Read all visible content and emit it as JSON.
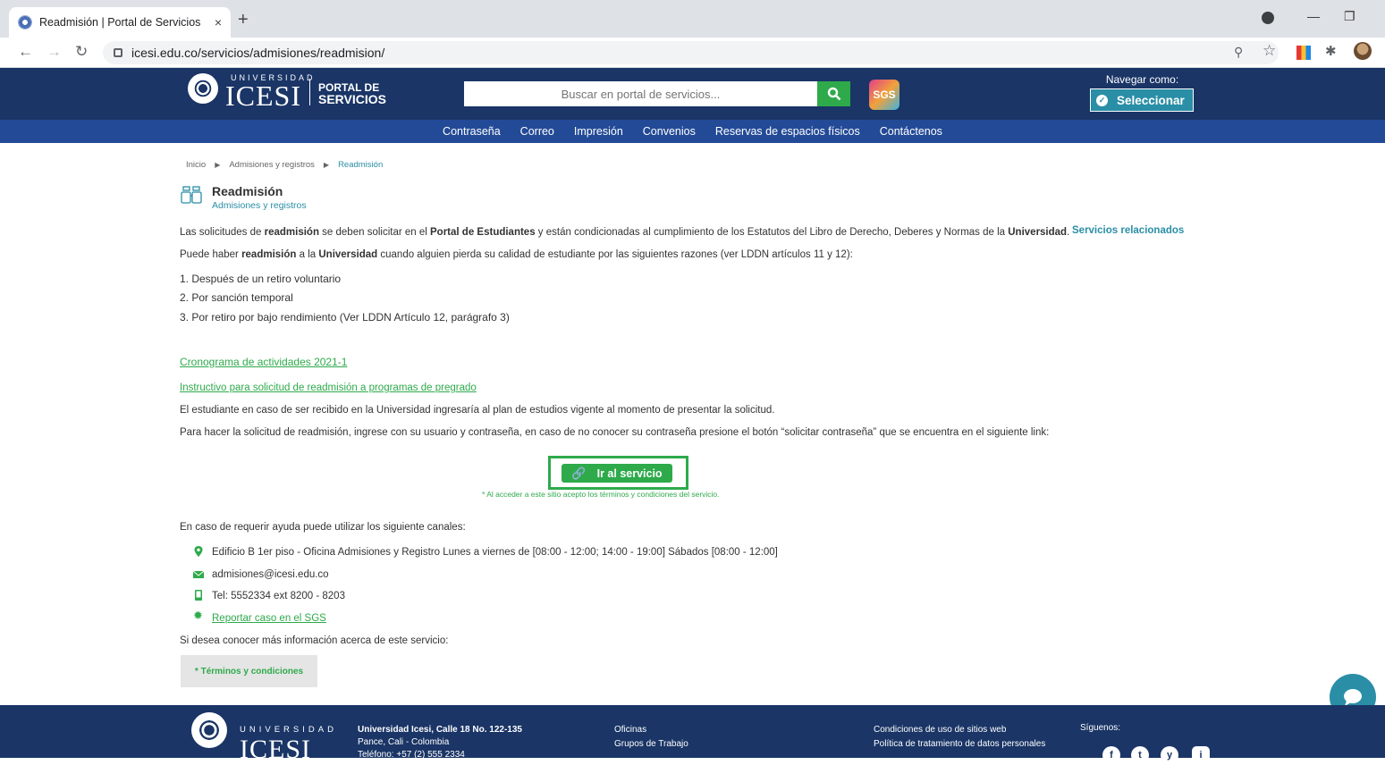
{
  "browser": {
    "tab_title": "Readmisión | Portal de Servicios",
    "tab_close": "×",
    "new_tab": "+",
    "url": "icesi.edu.co/servicios/admisiones/readmision/"
  },
  "header": {
    "logo_universidad": "UNIVERSIDAD",
    "logo_icesi": "ICESI",
    "logo_portal_1": "PORTAL DE",
    "logo_portal_2": "SERVICIOS",
    "search_placeholder": "Buscar en portal de servicios...",
    "sgs": "SGS",
    "navegar_label": "Navegar como:",
    "select_label": "Seleccionar"
  },
  "nav": [
    "Contraseña",
    "Correo",
    "Impresión",
    "Convenios",
    "Reservas de espacios físicos",
    "Contáctenos"
  ],
  "breadcrumb": {
    "home": "Inicio",
    "section": "Admisiones y registros",
    "current": "Readmisión"
  },
  "page": {
    "title": "Readmisión",
    "subtitle": "Admisiones y registros",
    "intro_a": "Las solicitudes de ",
    "intro_b": "readmisión",
    "intro_c": " se deben solicitar en el ",
    "intro_d": "Portal de Estudiantes",
    "intro_e": " y están condicionadas al cumplimiento de los Estatutos del Libro de Derecho, Deberes y Normas de la ",
    "intro_f": "Universidad",
    "intro_g": ".",
    "reason_a": "Puede haber ",
    "reason_b": "readmisión",
    "reason_c": " a la ",
    "reason_d": "Universidad",
    "reason_e": " cuando alguien pierda su calidad de estudiante por las siguientes razones (ver LDDN artículos 11 y 12):",
    "list": [
      "1. Después de un retiro voluntario",
      "2. Por sanción temporal",
      "3. Por retiro por bajo rendimiento (Ver LDDN Artículo 12, parágrafo 3)"
    ],
    "link_cronograma": "Cronograma de actividades 2021-1",
    "link_instructivo": "Instructivo para solicitud de readmisión a programas de pregrado",
    "plan_text": "El estudiante en caso de ser recibido en la Universidad ingresaría al plan de estudios vigente al momento de presentar la solicitud.",
    "login_text": "Para hacer la solicitud de readmisión, ingrese con su usuario y contraseña, en caso de no conocer su contraseña presione  el botón “solicitar contraseña” que se encuentra en el siguiente link:",
    "service_button": "Ir al servicio",
    "terms_note": "* Al acceder a este sitio acepto los términos y condiciones del servicio.",
    "help_text": "En caso de requerir ayuda puede utilizar los siguiente canales:",
    "contacts": {
      "location": "Edificio B 1er piso - Oficina Admisiones y Registro Lunes a viernes de [08:00 - 12:00; 14:00 - 19:00] Sábados [08:00 - 12:00]",
      "email": "admisiones@icesi.edu.co",
      "phone": "Tel: 5552334 ext 8200 - 8203",
      "sgs_link": "Reportar caso en el SGS"
    },
    "more_info": "Si desea conocer más información acerca de este servicio:",
    "terms_button": "* Términos y condiciones",
    "related": "Servicios relacionados"
  },
  "footer": {
    "universidad": "UNIVERSIDAD",
    "icesi": "ICESI",
    "address_1": "Universidad Icesi, Calle 18 No. 122-135",
    "address_2": "Pance, Cali - Colombia",
    "address_3": "Teléfono: +57 (2) 555 2334",
    "links_1": "Oficinas",
    "links_2": "Grupos de Trabajo",
    "legal_1": "Condiciones de uso de sitios web",
    "legal_2": "Política de tratamiento de datos personales",
    "siguenos": "Síguenos:",
    "social": [
      "f",
      "t",
      "y",
      "i"
    ]
  }
}
